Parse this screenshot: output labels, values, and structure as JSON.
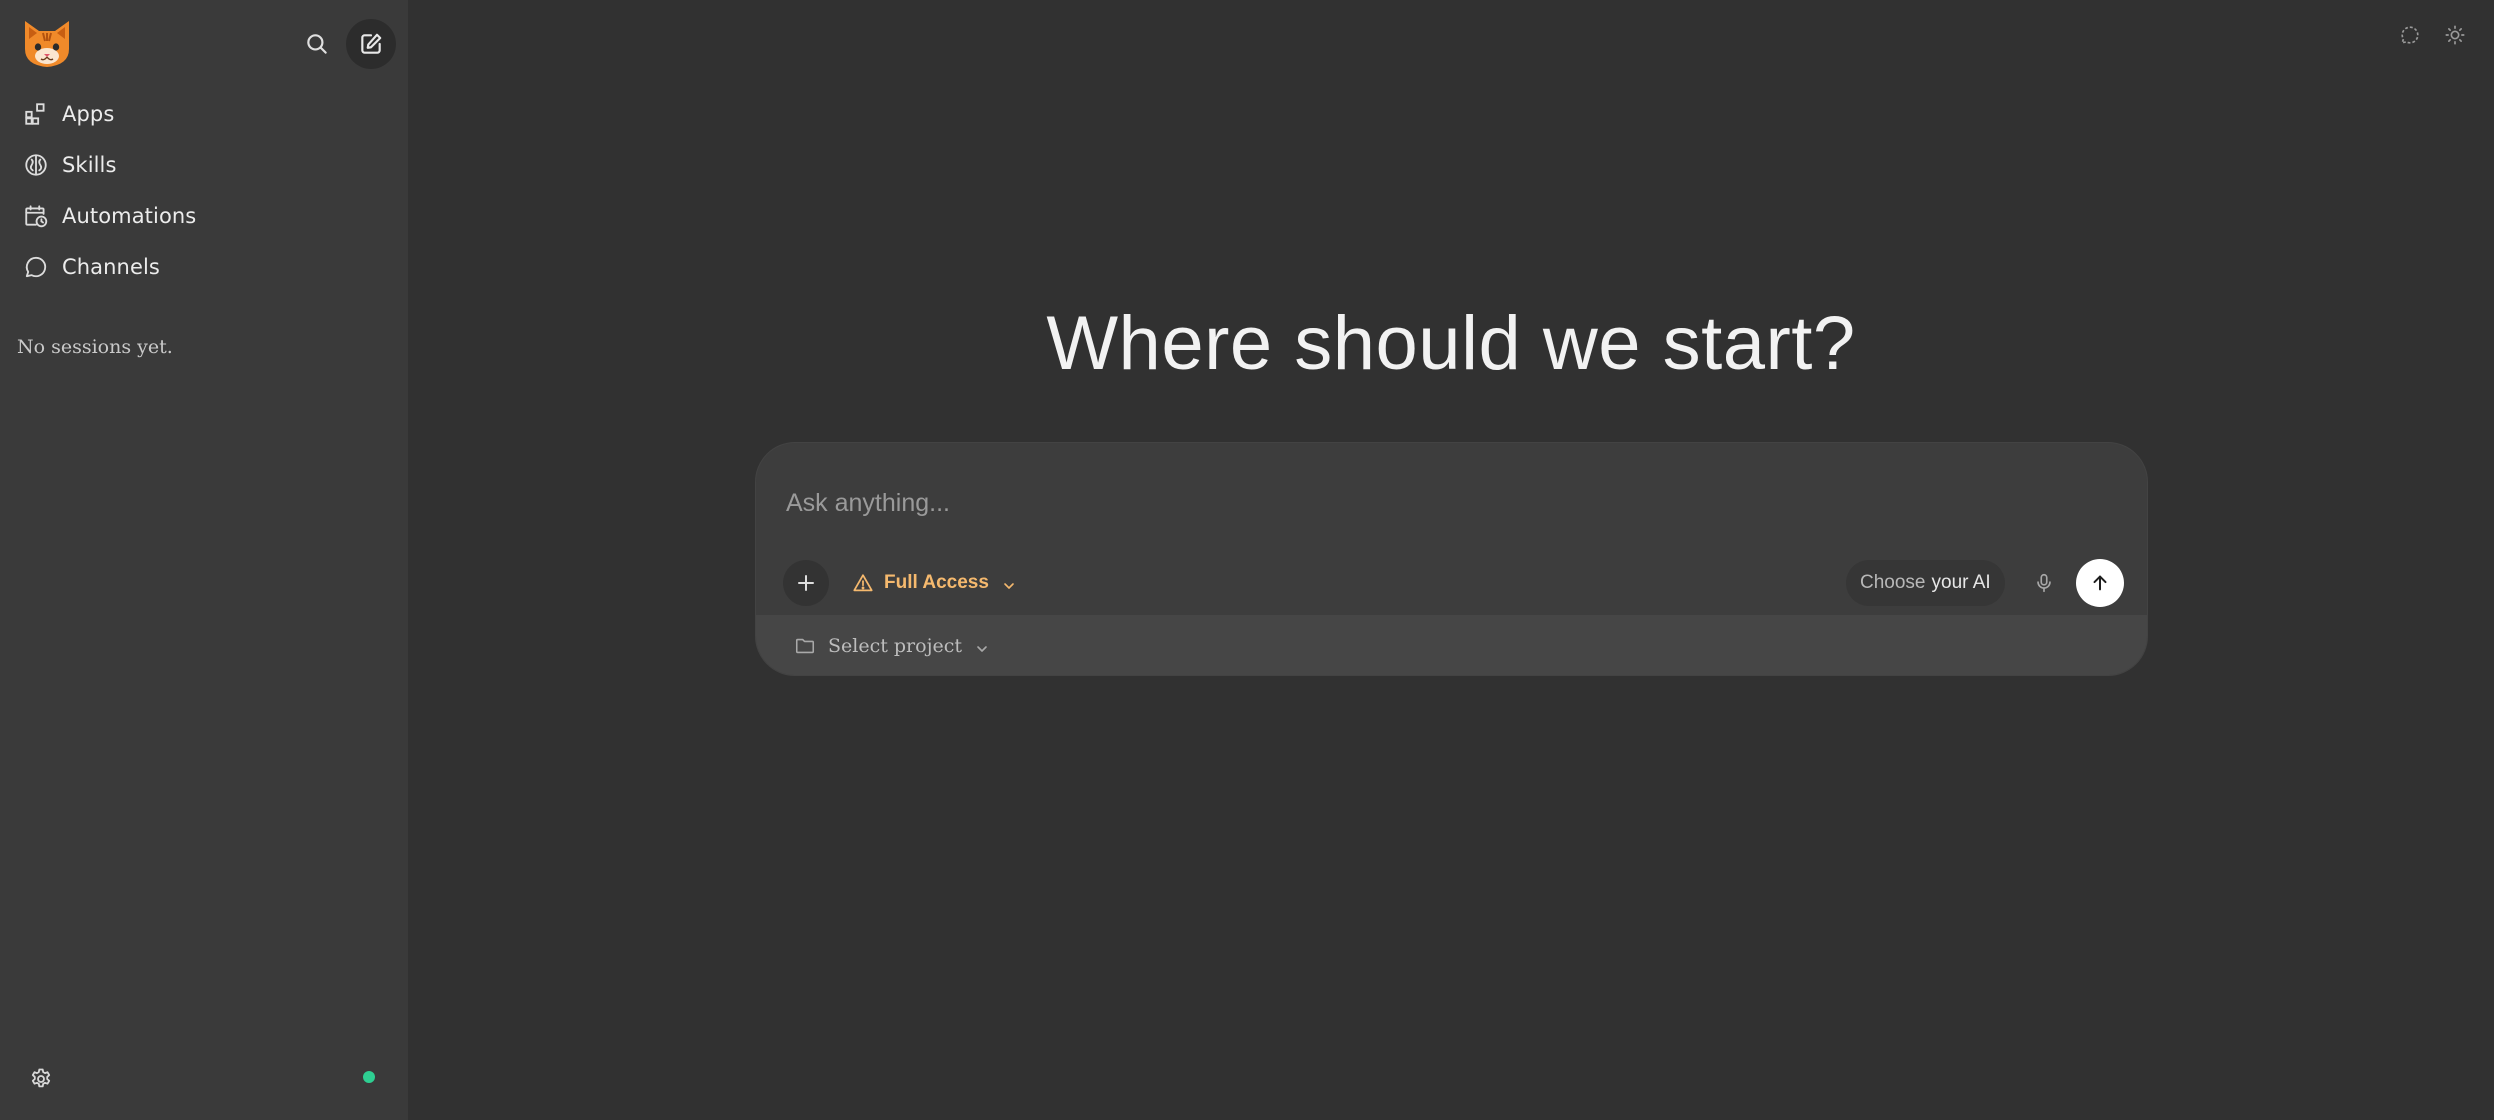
{
  "sidebar": {
    "logo_icon": "cat-logo-icon",
    "search_icon": "search-icon",
    "compose_icon": "new-chat-icon",
    "nav": [
      {
        "label": "Apps",
        "icon": "apps-icon"
      },
      {
        "label": "Skills",
        "icon": "brain-icon"
      },
      {
        "label": "Automations",
        "icon": "calendar-clock-icon"
      },
      {
        "label": "Channels",
        "icon": "chat-bubble-icon"
      }
    ],
    "empty_note": "No sessions yet.",
    "settings_icon": "gear-icon",
    "status_color": "#2ecf92"
  },
  "topbar": {
    "chat_icon": "chat-dashed-icon",
    "theme_icon": "sun-icon"
  },
  "main": {
    "heading": "Where should we start?"
  },
  "composer": {
    "placeholder": "Ask anything...",
    "value": "",
    "access_label": "Full Access",
    "access_color": "#f5b96e",
    "model_prefix": "Choose",
    "model_highlight": "your AI",
    "project_label": "Select project"
  }
}
